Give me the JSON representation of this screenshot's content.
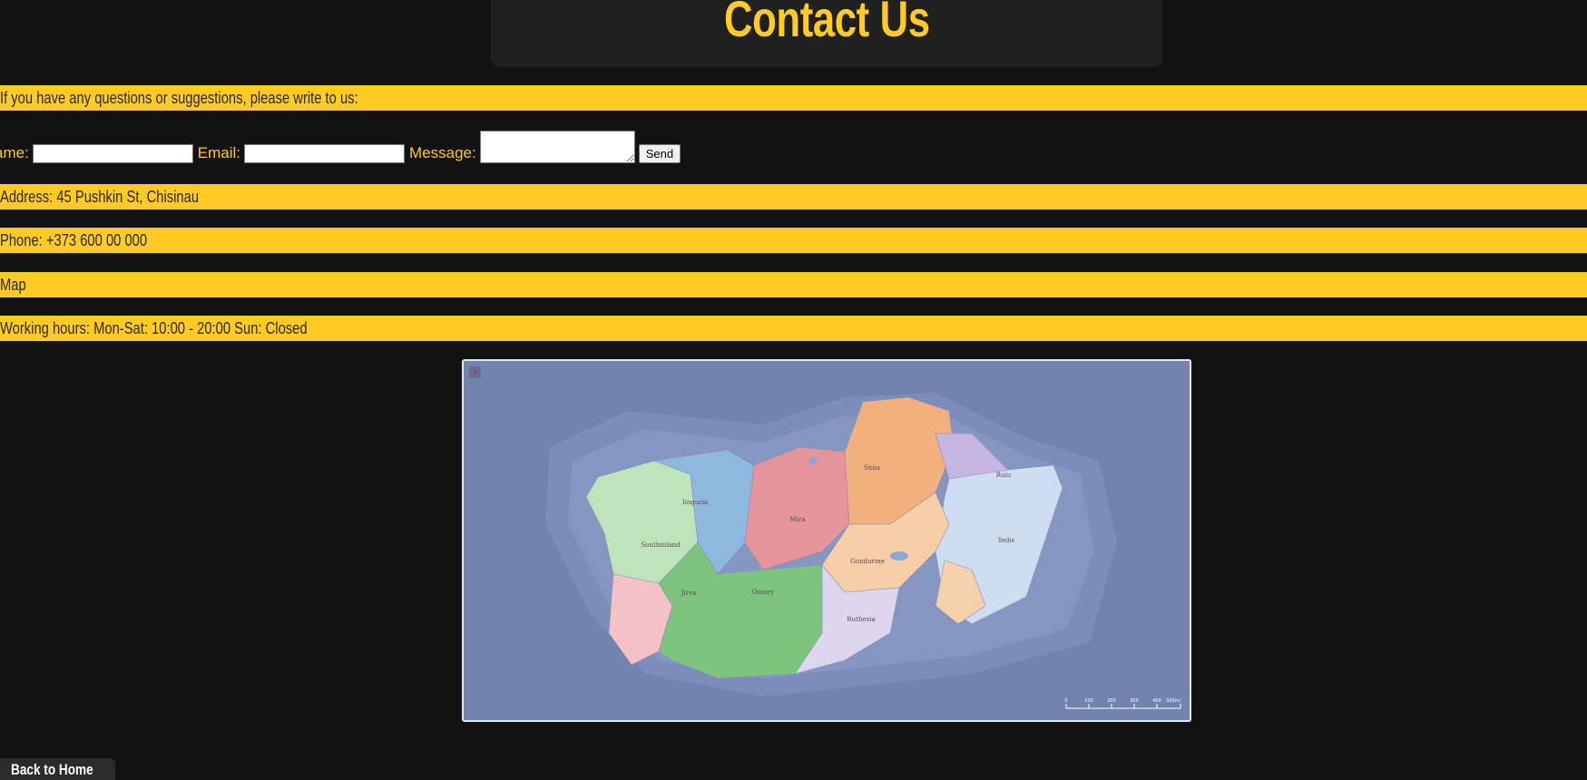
{
  "header": {
    "title": "Contact Us"
  },
  "intro": "If you have any questions or suggestions, please write to us:",
  "form": {
    "name_label": "ame:",
    "email_label": "Email:",
    "message_label": "Message:",
    "name_value": "",
    "email_value": "",
    "message_value": "",
    "send_label": "Send"
  },
  "info": {
    "address": "Address: 45 Pushkin St, Chisinau",
    "phone": "Phone: +373 600 00 000",
    "map_label": "Map",
    "hours": "Working hours: Mon-Sat: 10:00 - 20:00 Sun: Closed"
  },
  "map": {
    "toggle_icon": "›",
    "regions": [
      "Iinguria",
      "Mira",
      "Shiia",
      "Ruiu",
      "Southinland",
      "Yedis",
      "Gondurine",
      "Jirva",
      "Ossory",
      "Ruthesia"
    ],
    "scale_labels": [
      "0",
      "100",
      "200",
      "300",
      "400",
      "500mi"
    ]
  },
  "nav": {
    "back_label": "Back to Home"
  },
  "colors": {
    "accent": "#ffcb24",
    "background": "#121212",
    "band_text": "#2a2a2a"
  }
}
